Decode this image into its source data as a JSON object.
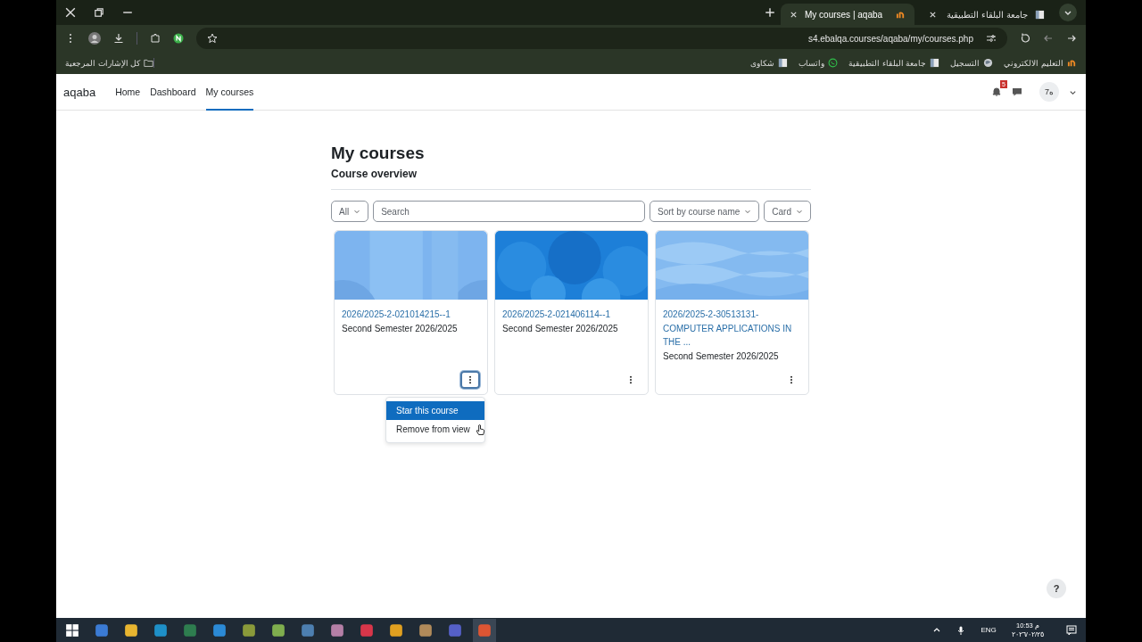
{
  "browser": {
    "tabs": [
      {
        "label": "My courses | aqaba",
        "selected": true
      },
      {
        "label": "جامعة البلقاء التطبيقية",
        "selected": false
      }
    ],
    "address": "s4.ebalqa.courses/aqaba/my/courses.php",
    "bookmarks": [
      {
        "label": "التعليم الالكتروني",
        "kind": "brand"
      },
      {
        "label": "التسجيل",
        "kind": "globe"
      },
      {
        "label": "جامعة البلقاء التطبيقية",
        "kind": "page"
      },
      {
        "label": "واتساب",
        "kind": "chat"
      },
      {
        "label": "شكاوى",
        "kind": "page"
      }
    ],
    "all_bookmarks": "كل الإشارات المرجعية"
  },
  "site": {
    "brand": "aqaba",
    "nav": [
      {
        "label": "Home",
        "selected": false
      },
      {
        "label": "Dashboard",
        "selected": false
      },
      {
        "label": "My courses",
        "selected": true
      }
    ],
    "notification_count": "5",
    "user_initials": "7ه"
  },
  "page": {
    "title": "My courses",
    "section": "Course overview",
    "filters": {
      "grouping": "All",
      "search": {
        "placeholder": "Search"
      },
      "sort": "Sort by course name",
      "view": "Card"
    },
    "courses": [
      {
        "title": "2026/2025-2-021014215--1",
        "category": "Second Semester 2026/2025",
        "menu_open": true,
        "menu": [
          {
            "label": "Star this course",
            "selected": true
          },
          {
            "label": "Remove from view",
            "selected": false
          }
        ]
      },
      {
        "title": "2026/2025-2-021406114--1",
        "category": "Second Semester 2026/2025",
        "menu_open": false
      },
      {
        "title": "2026/2025-2-30513131- COMPUTER APPLICATIONS IN THE ...",
        "category": "Second Semester 2026/2025",
        "menu_open": false
      }
    ],
    "help": "?"
  },
  "taskbar": {
    "language": "ENG",
    "time": "10:53 م",
    "date": "٢٠٢٦/٠٢/٢٥"
  }
}
